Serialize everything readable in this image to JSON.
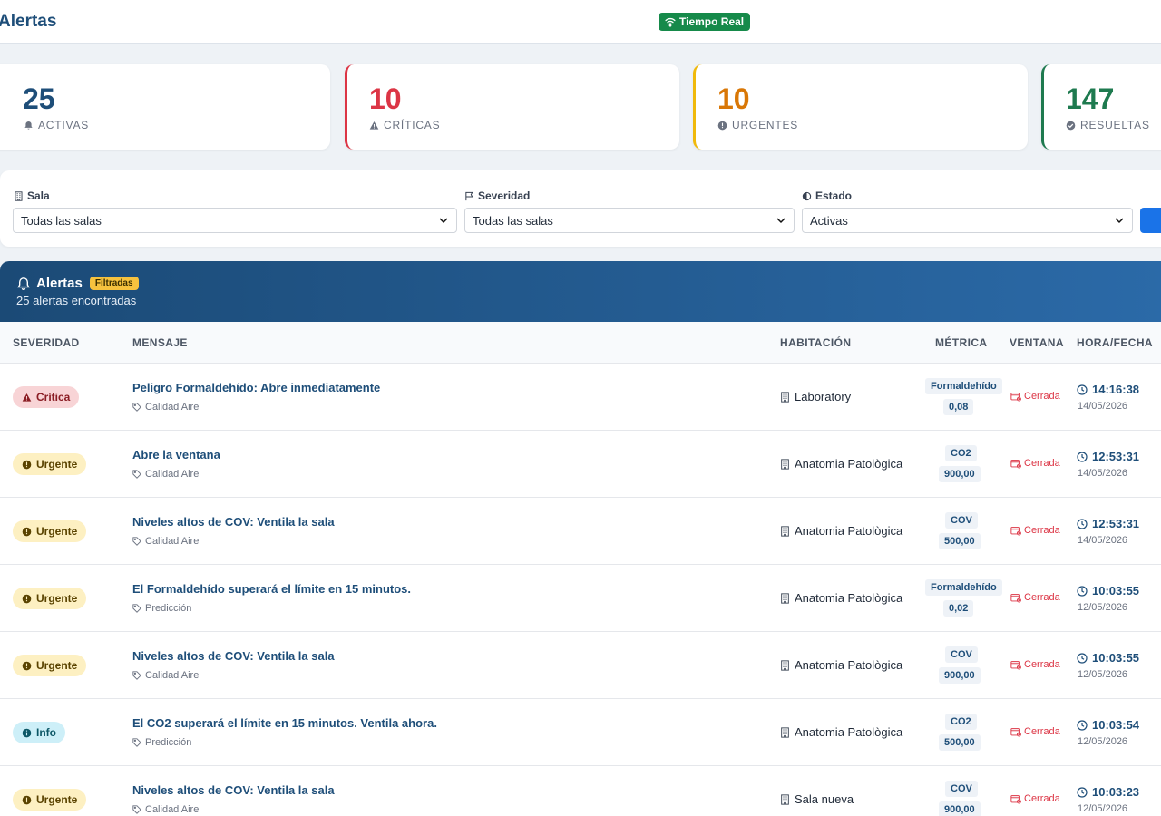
{
  "header": {
    "title": "Alertas",
    "realtime_label": "Tiempo Real",
    "realtime_color": "#168a4a"
  },
  "stats": [
    {
      "value": "25",
      "label": "ACTIVAS",
      "icon": "bell-icon",
      "color": "#1e4e79"
    },
    {
      "value": "10",
      "label": "CRÍTICAS",
      "icon": "warning-icon",
      "color": "#dc3545"
    },
    {
      "value": "10",
      "label": "URGENTES",
      "icon": "exclamation-circle-icon",
      "color": "#d97706"
    },
    {
      "value": "147",
      "label": "RESUELTAS",
      "icon": "check-circle-icon",
      "color": "#1e7a4f"
    }
  ],
  "filters": {
    "sala": {
      "label": "Sala",
      "value": "Todas las salas"
    },
    "severidad": {
      "label": "Severidad",
      "value": "Todas las salas"
    },
    "estado": {
      "label": "Estado",
      "value": "Activas"
    }
  },
  "panel": {
    "title": "Alertas",
    "badge": "Filtradas",
    "subtitle": "25 alertas encontradas",
    "columns": [
      "SEVERIDAD",
      "MENSAJE",
      "HABITACIÓN",
      "MÉTRICA",
      "VENTANA",
      "HORA/FECHA"
    ]
  },
  "rows": [
    {
      "severity": "Crítica",
      "message": "Peligro Formaldehído: Abre inmediatamente",
      "category": "Calidad Aire",
      "room": "Laboratory",
      "metric": "Formaldehído",
      "value": "0,08",
      "window": "Cerrada",
      "time": "14:16:38",
      "date": "14/05/2026"
    },
    {
      "severity": "Urgente",
      "message": "Abre la ventana",
      "category": "Calidad Aire",
      "room": "Anatomia Patològica",
      "metric": "CO2",
      "value": "900,00",
      "window": "Cerrada",
      "time": "12:53:31",
      "date": "14/05/2026"
    },
    {
      "severity": "Urgente",
      "message": "Niveles altos de COV: Ventila la sala",
      "category": "Calidad Aire",
      "room": "Anatomia Patològica",
      "metric": "COV",
      "value": "500,00",
      "window": "Cerrada",
      "time": "12:53:31",
      "date": "14/05/2026"
    },
    {
      "severity": "Urgente",
      "message": "El Formaldehído superará el límite en 15 minutos.",
      "category": "Predicción",
      "room": "Anatomia Patològica",
      "metric": "Formaldehído",
      "value": "0,02",
      "window": "Cerrada",
      "time": "10:03:55",
      "date": "12/05/2026"
    },
    {
      "severity": "Urgente",
      "message": "Niveles altos de COV: Ventila la sala",
      "category": "Calidad Aire",
      "room": "Anatomia Patològica",
      "metric": "COV",
      "value": "900,00",
      "window": "Cerrada",
      "time": "10:03:55",
      "date": "12/05/2026"
    },
    {
      "severity": "Info",
      "message": "El CO2 superará el límite en 15 minutos. Ventila ahora.",
      "category": "Predicción",
      "room": "Anatomia Patològica",
      "metric": "CO2",
      "value": "500,00",
      "window": "Cerrada",
      "time": "10:03:54",
      "date": "12/05/2026"
    },
    {
      "severity": "Urgente",
      "message": "Niveles altos de COV: Ventila la sala",
      "category": "Calidad Aire",
      "room": "Sala nueva",
      "metric": "COV",
      "value": "900,00",
      "window": "Cerrada",
      "time": "10:03:23",
      "date": "12/05/2026"
    }
  ]
}
